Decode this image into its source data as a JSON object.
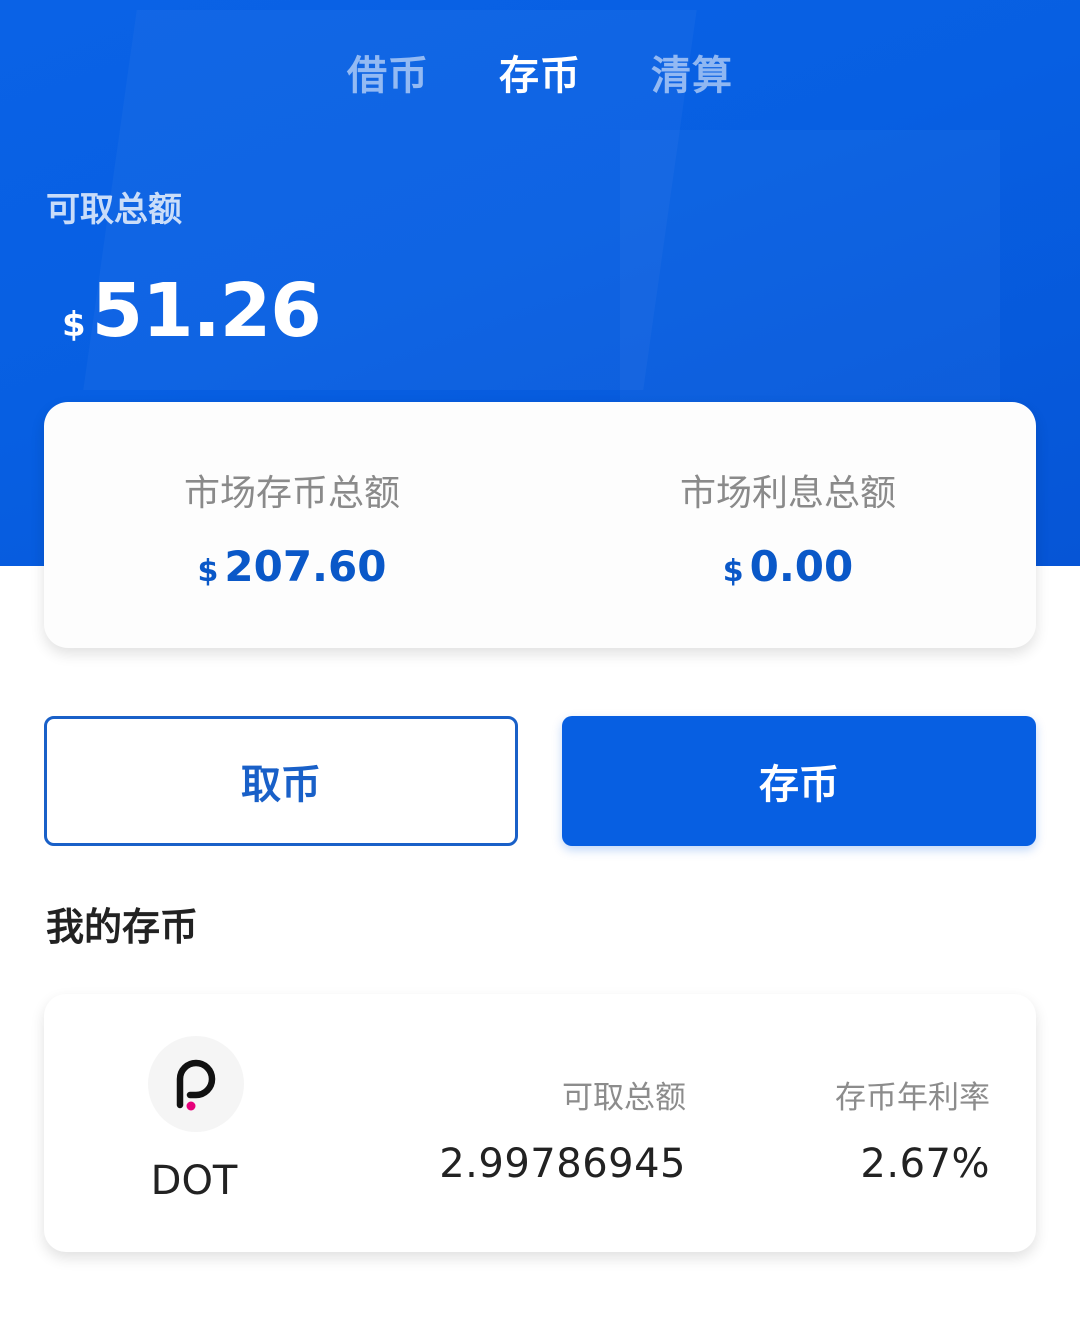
{
  "tabs": [
    {
      "label": "借币",
      "active": false
    },
    {
      "label": "存币",
      "active": true
    },
    {
      "label": "清算",
      "active": false
    }
  ],
  "summary": {
    "label": "可取总额",
    "currency": "$",
    "amount": "51.26"
  },
  "market": {
    "deposit_label": "市场存币总额",
    "deposit_currency": "$",
    "deposit_value": "207.60",
    "interest_label": "市场利息总额",
    "interest_currency": "$",
    "interest_value": "0.00"
  },
  "actions": {
    "withdraw_label": "取币",
    "deposit_label": "存币"
  },
  "my_deposits": {
    "title": "我的存币",
    "assets": [
      {
        "symbol": "DOT",
        "icon": "polkadot-icon",
        "available_label": "可取总额",
        "available_value": "2.99786945",
        "rate_label": "存币年利率",
        "rate_value": "2.67%"
      }
    ]
  },
  "colors": {
    "brand_blue": "#075fe2",
    "value_blue": "#0a58c8",
    "polkadot_pink": "#e6007a"
  }
}
